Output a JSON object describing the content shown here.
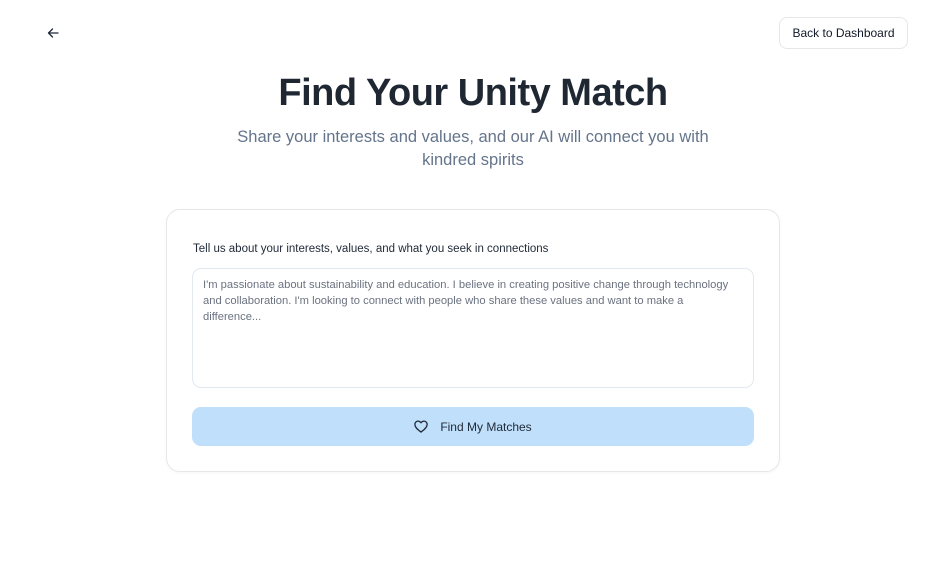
{
  "header": {
    "back_icon": "arrow-left-icon",
    "dashboard_label": "Back to Dashboard"
  },
  "hero": {
    "title": "Find Your Unity Match",
    "subtitle": "Share your interests and values, and our AI will connect you with kindred spirits"
  },
  "form": {
    "label": "Tell us about your interests, values, and what you seek in connections",
    "textarea_value": "",
    "textarea_placeholder": "I'm passionate about sustainability and education. I believe in creating positive change through technology and collaboration. I'm looking to connect with people who share these values and want to make a difference...",
    "submit_label": "Find My Matches",
    "submit_icon": "heart-icon"
  },
  "colors": {
    "button_bg": "#bfdffa",
    "title_text": "#1f2733",
    "subtitle_text": "#64748b",
    "border": "#e5e7eb"
  }
}
